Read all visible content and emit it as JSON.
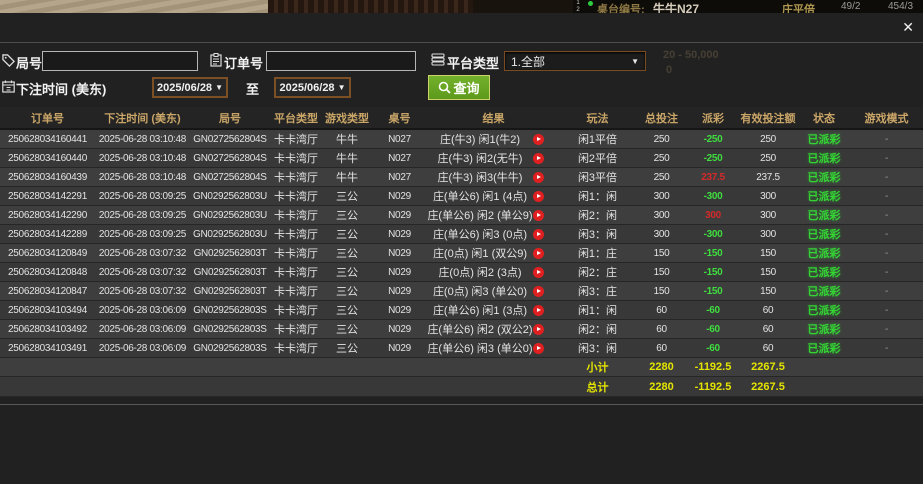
{
  "background": {
    "list_num_1": "1",
    "list_num_2": "2",
    "table_label": "桌台编号:",
    "table_name": "牛牛N27",
    "bet_limit_label": "庄平倍",
    "stat_1": "49/2",
    "stat_2": "454/3",
    "bleed_line_1": "20 - 50,000",
    "bleed_line_2": "0"
  },
  "icons": {
    "close": "✕",
    "chevron_down": "▼"
  },
  "filters": {
    "round_label": "局号",
    "round_value": "",
    "order_label": "订单号",
    "order_value": "",
    "platform_label": "平台类型",
    "platform_value": "1.全部",
    "bet_time_label": "下注时间 (美东)",
    "date_from": "2025/06/28",
    "range_to_label": "至",
    "date_to": "2025/06/28",
    "query_label": "查询"
  },
  "table": {
    "headers": [
      "订单号",
      "下注时间 (美东)",
      "局号",
      "平台类型",
      "游戏类型",
      "桌号",
      "结果",
      "玩法",
      "总投注",
      "派彩",
      "有效投注额",
      "状态",
      "游戏模式"
    ],
    "rows": [
      {
        "order": "250628034160441",
        "time": "2025-06-28 03:10:48",
        "round": "GN0272562804S",
        "platform": "卡卡湾厅",
        "game": "牛牛",
        "table_no": "N027",
        "result": "庄(牛3) 闲1(牛2)",
        "play_type": "闲1平倍",
        "total_bet": "250",
        "payout": "-250",
        "payout_color": "negative",
        "valid_bet": "250",
        "status": "已派彩",
        "mode": "-"
      },
      {
        "order": "250628034160440",
        "time": "2025-06-28 03:10:48",
        "round": "GN0272562804S",
        "platform": "卡卡湾厅",
        "game": "牛牛",
        "table_no": "N027",
        "result": "庄(牛3) 闲2(无牛)",
        "play_type": "闲2平倍",
        "total_bet": "250",
        "payout": "-250",
        "payout_color": "negative",
        "valid_bet": "250",
        "status": "已派彩",
        "mode": "-"
      },
      {
        "order": "250628034160439",
        "time": "2025-06-28 03:10:48",
        "round": "GN0272562804S",
        "platform": "卡卡湾厅",
        "game": "牛牛",
        "table_no": "N027",
        "result": "庄(牛3) 闲3(牛牛)",
        "play_type": "闲3平倍",
        "total_bet": "250",
        "payout": "237.5",
        "payout_color": "positive",
        "valid_bet": "237.5",
        "status": "已派彩",
        "mode": "-"
      },
      {
        "order": "250628034142291",
        "time": "2025-06-28 03:09:25",
        "round": "GN0292562803U",
        "platform": "卡卡湾厅",
        "game": "三公",
        "table_no": "N029",
        "result": "庄(单公6) 闲1 (4点)",
        "play_type": "闲1：闲",
        "total_bet": "300",
        "payout": "-300",
        "payout_color": "negative",
        "valid_bet": "300",
        "status": "已派彩",
        "mode": "-"
      },
      {
        "order": "250628034142290",
        "time": "2025-06-28 03:09:25",
        "round": "GN0292562803U",
        "platform": "卡卡湾厅",
        "game": "三公",
        "table_no": "N029",
        "result": "庄(单公6) 闲2 (单公9)",
        "play_type": "闲2：闲",
        "total_bet": "300",
        "payout": "300",
        "payout_color": "positive",
        "valid_bet": "300",
        "status": "已派彩",
        "mode": "-"
      },
      {
        "order": "250628034142289",
        "time": "2025-06-28 03:09:25",
        "round": "GN0292562803U",
        "platform": "卡卡湾厅",
        "game": "三公",
        "table_no": "N029",
        "result": "庄(单公6) 闲3 (0点)",
        "play_type": "闲3：闲",
        "total_bet": "300",
        "payout": "-300",
        "payout_color": "negative",
        "valid_bet": "300",
        "status": "已派彩",
        "mode": "-"
      },
      {
        "order": "250628034120849",
        "time": "2025-06-28 03:07:32",
        "round": "GN0292562803T",
        "platform": "卡卡湾厅",
        "game": "三公",
        "table_no": "N029",
        "result": "庄(0点) 闲1 (双公9)",
        "play_type": "闲1：庄",
        "total_bet": "150",
        "payout": "-150",
        "payout_color": "negative",
        "valid_bet": "150",
        "status": "已派彩",
        "mode": "-"
      },
      {
        "order": "250628034120848",
        "time": "2025-06-28 03:07:32",
        "round": "GN0292562803T",
        "platform": "卡卡湾厅",
        "game": "三公",
        "table_no": "N029",
        "result": "庄(0点) 闲2 (3点)",
        "play_type": "闲2：庄",
        "total_bet": "150",
        "payout": "-150",
        "payout_color": "negative",
        "valid_bet": "150",
        "status": "已派彩",
        "mode": "-"
      },
      {
        "order": "250628034120847",
        "time": "2025-06-28 03:07:32",
        "round": "GN0292562803T",
        "platform": "卡卡湾厅",
        "game": "三公",
        "table_no": "N029",
        "result": "庄(0点) 闲3 (单公0)",
        "play_type": "闲3：庄",
        "total_bet": "150",
        "payout": "-150",
        "payout_color": "negative",
        "valid_bet": "150",
        "status": "已派彩",
        "mode": "-"
      },
      {
        "order": "250628034103494",
        "time": "2025-06-28 03:06:09",
        "round": "GN0292562803S",
        "platform": "卡卡湾厅",
        "game": "三公",
        "table_no": "N029",
        "result": "庄(单公6) 闲1 (3点)",
        "play_type": "闲1：闲",
        "total_bet": "60",
        "payout": "-60",
        "payout_color": "negative",
        "valid_bet": "60",
        "status": "已派彩",
        "mode": "-"
      },
      {
        "order": "250628034103492",
        "time": "2025-06-28 03:06:09",
        "round": "GN0292562803S",
        "platform": "卡卡湾厅",
        "game": "三公",
        "table_no": "N029",
        "result": "庄(单公6) 闲2 (双公2)",
        "play_type": "闲2：闲",
        "total_bet": "60",
        "payout": "-60",
        "payout_color": "negative",
        "valid_bet": "60",
        "status": "已派彩",
        "mode": "-"
      },
      {
        "order": "250628034103491",
        "time": "2025-06-28 03:06:09",
        "round": "GN0292562803S",
        "platform": "卡卡湾厅",
        "game": "三公",
        "table_no": "N029",
        "result": "庄(单公6) 闲3 (单公0)",
        "play_type": "闲3：闲",
        "total_bet": "60",
        "payout": "-60",
        "payout_color": "negative",
        "valid_bet": "60",
        "status": "已派彩",
        "mode": "-"
      }
    ],
    "summary": [
      {
        "label": "小计",
        "total_bet": "2280",
        "payout": "-1192.5",
        "valid_bet": "2267.5"
      },
      {
        "label": "总计",
        "total_bet": "2280",
        "payout": "-1192.5",
        "valid_bet": "2267.5"
      }
    ]
  },
  "colors": {
    "header_text": "#c9a567",
    "payout_negative": "#3fdd3f",
    "payout_positive": "#d42a2a",
    "status_paid": "#35d435",
    "summary_yellow": "#e4e400",
    "query_button": "#5d9a1b"
  }
}
